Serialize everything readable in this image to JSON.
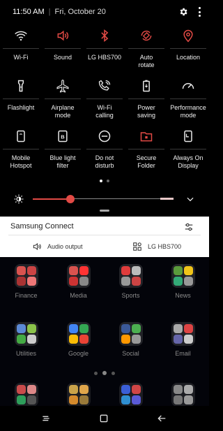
{
  "status_bar": {
    "time": "11:50 AM",
    "date": "Fri, October 20",
    "settings_icon": "gear-icon",
    "more_icon": "more-vertical-icon"
  },
  "quick_settings": [
    {
      "label": "Wi-Fi",
      "icon": "wifi-icon",
      "active": false
    },
    {
      "label": "Sound",
      "icon": "speaker-icon",
      "active": true
    },
    {
      "label": "LG HBS700",
      "icon": "bluetooth-icon",
      "active": true
    },
    {
      "label": "Auto\nrotate",
      "icon": "auto-rotate-icon",
      "active": true
    },
    {
      "label": "Location",
      "icon": "location-pin-icon",
      "active": true
    },
    {
      "label": "Flashlight",
      "icon": "flashlight-icon",
      "active": false
    },
    {
      "label": "Airplane\nmode",
      "icon": "airplane-icon",
      "active": false
    },
    {
      "label": "Wi-Fi\ncalling",
      "icon": "wifi-calling-icon",
      "active": false
    },
    {
      "label": "Power\nsaving",
      "icon": "power-saving-icon",
      "active": false
    },
    {
      "label": "Performance\nmode",
      "icon": "performance-gauge-icon",
      "active": false
    },
    {
      "label": "Mobile\nHotspot",
      "icon": "mobile-hotspot-icon",
      "active": false
    },
    {
      "label": "Blue light\nfilter",
      "icon": "blue-light-filter-icon",
      "active": false
    },
    {
      "label": "Do not\ndisturb",
      "icon": "do-not-disturb-icon",
      "active": false
    },
    {
      "label": "Secure\nFolder",
      "icon": "secure-folder-icon",
      "active": true
    },
    {
      "label": "Always On\nDisplay",
      "icon": "always-on-display-icon",
      "active": false
    }
  ],
  "quick_settings_pages": {
    "count": 2,
    "current": 0
  },
  "brightness": {
    "level": 0.22,
    "icon": "brightness-auto-icon",
    "expand_icon": "chevron-down-icon"
  },
  "samsung_connect": {
    "title": "Samsung Connect",
    "settings_icon": "sliders-icon",
    "audio_output_label": "Audio output",
    "audio_icon": "speaker-waves-icon",
    "device_label": "LG HBS700",
    "device_icon": "device-grid-icon"
  },
  "home_apps": [
    {
      "label": "Finance"
    },
    {
      "label": "Media"
    },
    {
      "label": "Sports"
    },
    {
      "label": "News"
    },
    {
      "label": "Utilities"
    },
    {
      "label": "Google"
    },
    {
      "label": "Social"
    },
    {
      "label": "Email"
    }
  ],
  "home_pages": {
    "count": 3,
    "current": 1
  },
  "colors": {
    "accent": "#e24a45",
    "panel": "#000000",
    "connect_bg": "#ffffff"
  },
  "nav_bar": {
    "recents_icon": "recents-icon",
    "home_icon": "home-icon",
    "back_icon": "back-arrow-icon"
  }
}
